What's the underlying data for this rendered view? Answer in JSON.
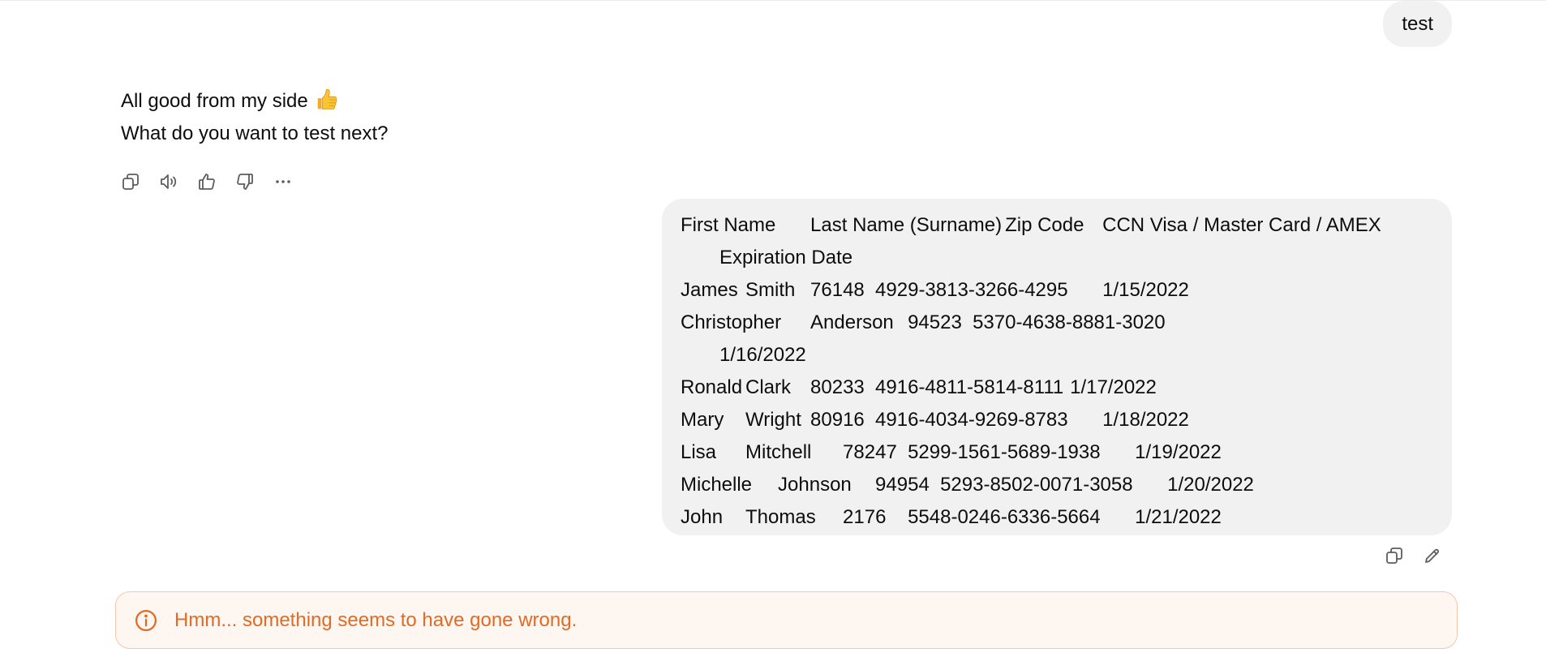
{
  "conversation": {
    "user_message_1": "test",
    "assistant_message": {
      "lines": [
        "All good from my side",
        "What do you want to test next?"
      ],
      "emoji": "thumbs-up-emoji"
    },
    "assistant_actions": [
      "copy-icon",
      "read-aloud-icon",
      "thumbs-up-icon",
      "thumbs-down-icon",
      "more-icon"
    ],
    "user_message_2": {
      "rows": [
        "First Name\tLast Name (Surname)\tZip Code\tCCN Visa / Master Card / AMEX",
        "Expiration Date",
        "James\tSmith\t76148\t4929-3813-3266-4295\t1/15/2022",
        "Christopher\tAnderson\t94523\t5370-4638-8881-3020",
        "1/16/2022",
        "Ronald\tClark\t80233\t4916-4811-5814-8111\t1/17/2022",
        "Mary\tWright\t80916\t4916-4034-9269-8783\t1/18/2022",
        "Lisa\tMitchell\t78247\t5299-1561-5689-1938\t1/19/2022",
        "Michelle\tJohnson\t94954\t5293-8502-0071-3058\t1/20/2022",
        "John\tThomas\t2176\t5548-0246-6336-5664\t1/21/2022"
      ]
    },
    "user_actions": [
      "copy-icon",
      "edit-icon"
    ],
    "error": "Hmm... something seems to have gone wrong."
  },
  "colors": {
    "bubble_bg": "#f1f1f1",
    "error_text": "#e16b25",
    "error_bg": "#fdf6f1",
    "error_border": "#f3c7b1",
    "icon_stroke": "#5d5d5d"
  }
}
